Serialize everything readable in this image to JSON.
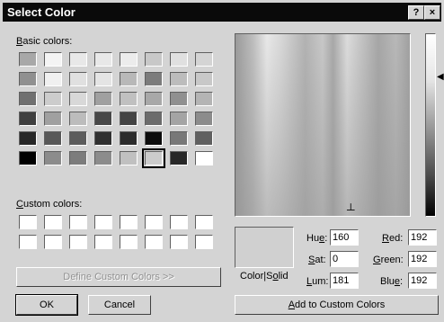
{
  "window": {
    "title": "Select Color",
    "help_label": "?",
    "close_label": "×"
  },
  "basic_colors": {
    "label": "Basic colors:",
    "rows": [
      [
        "#a8a8a8",
        "#f4f4f4",
        "#e8e8e8",
        "#e8e8e8",
        "#ececec",
        "#c8c8c8",
        "#e0e0e0",
        "#d4d4d4"
      ],
      [
        "#909090",
        "#f0f0f0",
        "#e0e0e0",
        "#e4e4e4",
        "#b8b8b8",
        "#7c7c7c",
        "#bcbcbc",
        "#c8c8c8"
      ],
      [
        "#707070",
        "#cccccc",
        "#d8d8d8",
        "#a0a0a0",
        "#c0c0c0",
        "#a8a8a8",
        "#909090",
        "#b4b4b4"
      ],
      [
        "#404040",
        "#a0a0a0",
        "#bcbcbc",
        "#484848",
        "#444444",
        "#6c6c6c",
        "#a4a4a4",
        "#8c8c8c"
      ],
      [
        "#282828",
        "#585858",
        "#5c5c5c",
        "#303030",
        "#2c2c2c",
        "#0c0c0c",
        "#787878",
        "#606060"
      ],
      [
        "#000000",
        "#8c8c8c",
        "#7c7c7c",
        "#8c8c8c",
        "#c0c0c0",
        "#cccccc",
        "#282828",
        "#ffffff"
      ]
    ],
    "selected_row": 5,
    "selected_col": 5
  },
  "custom_colors": {
    "label": "Custom colors:",
    "rows": [
      [
        "#ffffff",
        "#ffffff",
        "#ffffff",
        "#ffffff",
        "#ffffff",
        "#ffffff",
        "#ffffff",
        "#ffffff"
      ],
      [
        "#ffffff",
        "#ffffff",
        "#ffffff",
        "#ffffff",
        "#ffffff",
        "#ffffff",
        "#ffffff",
        "#ffffff"
      ]
    ]
  },
  "buttons": {
    "define_custom": "Define Custom Colors >>",
    "ok": "OK",
    "cancel": "Cancel",
    "add_custom": "Add to Custom Colors"
  },
  "preview": {
    "label": "Color|Solid",
    "color": "#d0d0d0"
  },
  "fields": {
    "hue_label": "Hue:",
    "hue": "160",
    "sat_label": "Sat:",
    "sat": "0",
    "lum_label": "Lum:",
    "lum": "181",
    "red_label": "Red:",
    "red": "192",
    "green_label": "Green:",
    "green": "192",
    "blue_label": "Blue:",
    "blue": "192"
  },
  "indicators": {
    "crosshair_glyph": "┴",
    "lum_arrow_glyph": "◀"
  }
}
